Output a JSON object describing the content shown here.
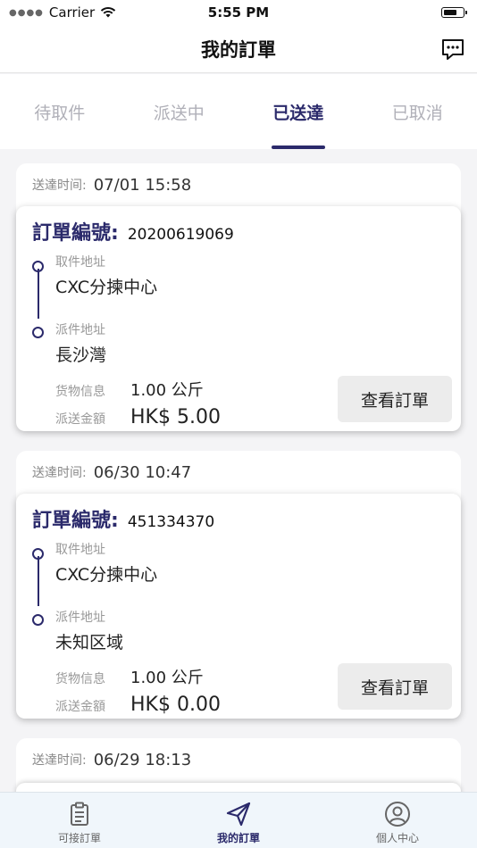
{
  "status_bar": {
    "carrier": "Carrier",
    "time": "5:55 PM"
  },
  "nav": {
    "title": "我的訂單"
  },
  "tabs": [
    {
      "label": "待取件",
      "active": false
    },
    {
      "label": "派送中",
      "active": false
    },
    {
      "label": "已送達",
      "active": true
    },
    {
      "label": "已取消",
      "active": false
    }
  ],
  "orders": [
    {
      "delivered_label": "送達时间:",
      "delivered_time": "07/01 15:58",
      "order_no_label": "訂單編號:",
      "order_no": "20200619069",
      "pickup_label": "取件地址",
      "pickup_address": "CXC分揀中心",
      "dropoff_label": "派件地址",
      "dropoff_address": "長沙灣",
      "cargo_label": "货物信息",
      "cargo_value": "1.00 公斤",
      "amount_label": "派送金額",
      "amount_value": "HK$ 5.00",
      "button_label": "查看訂單"
    },
    {
      "delivered_label": "送達时间:",
      "delivered_time": "06/30 10:47",
      "order_no_label": "訂單編號:",
      "order_no": "451334370",
      "pickup_label": "取件地址",
      "pickup_address": "CXC分揀中心",
      "dropoff_label": "派件地址",
      "dropoff_address": "未知区域",
      "cargo_label": "货物信息",
      "cargo_value": "1.00 公斤",
      "amount_label": "派送金額",
      "amount_value": "HK$ 0.00",
      "button_label": "查看訂單"
    }
  ],
  "partial_order": {
    "delivered_label": "送達时间:",
    "delivered_time": "06/29 18:13"
  },
  "tab_bar": [
    {
      "label": "可接訂單",
      "icon": "clipboard-icon",
      "active": false
    },
    {
      "label": "我的訂單",
      "icon": "send-icon",
      "active": true
    },
    {
      "label": "個人中心",
      "icon": "user-circle-icon",
      "active": false
    }
  ],
  "colors": {
    "accent": "#2b2a6b",
    "inactive_tab": "#b0b0b8",
    "button_bg": "#ececec"
  }
}
